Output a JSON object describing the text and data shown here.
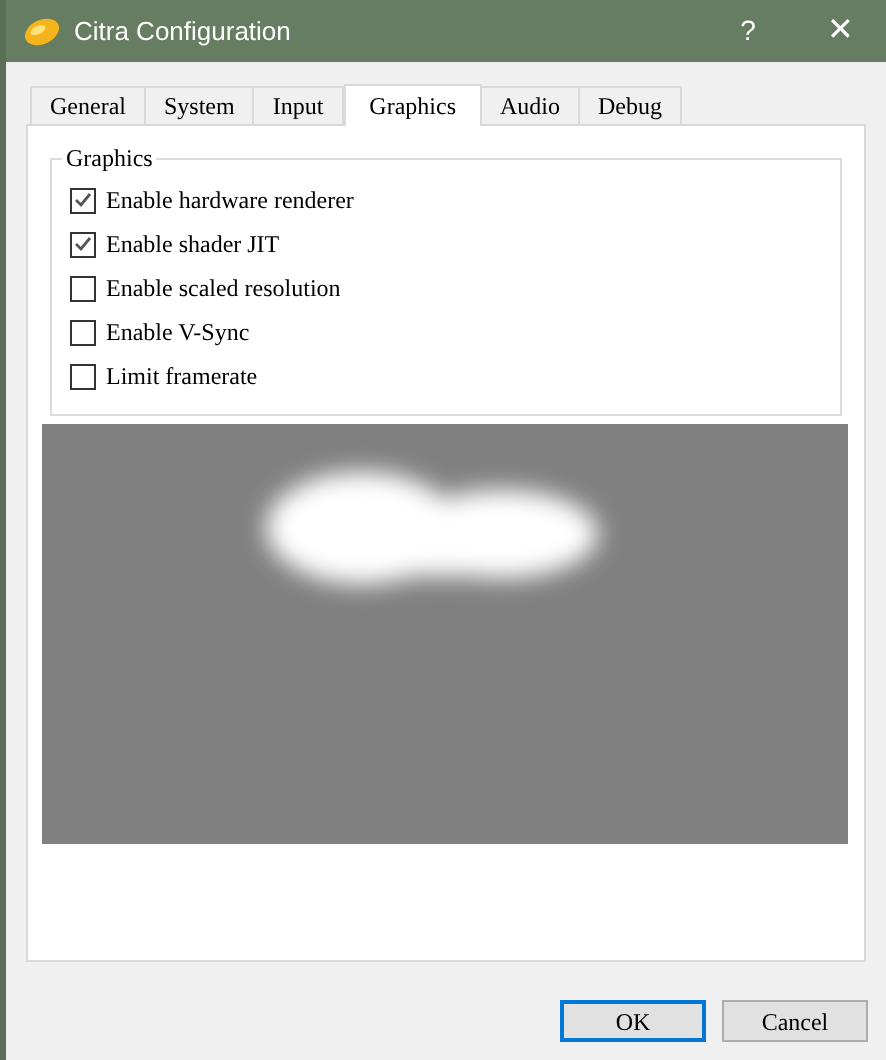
{
  "window": {
    "title": "Citra Configuration",
    "help": "?",
    "close": "✕"
  },
  "tabs": [
    {
      "label": "General",
      "selected": false
    },
    {
      "label": "System",
      "selected": false
    },
    {
      "label": "Input",
      "selected": false
    },
    {
      "label": "Graphics",
      "selected": true
    },
    {
      "label": "Audio",
      "selected": false
    },
    {
      "label": "Debug",
      "selected": false
    }
  ],
  "group": {
    "title": "Graphics",
    "options": [
      {
        "label": "Enable hardware renderer",
        "checked": true
      },
      {
        "label": "Enable shader JIT",
        "checked": true
      },
      {
        "label": "Enable scaled resolution",
        "checked": false
      },
      {
        "label": "Enable V-Sync",
        "checked": false
      },
      {
        "label": "Limit framerate",
        "checked": false
      }
    ]
  },
  "buttons": [
    {
      "label": "OK",
      "default": true
    },
    {
      "label": "Cancel",
      "default": false
    }
  ]
}
